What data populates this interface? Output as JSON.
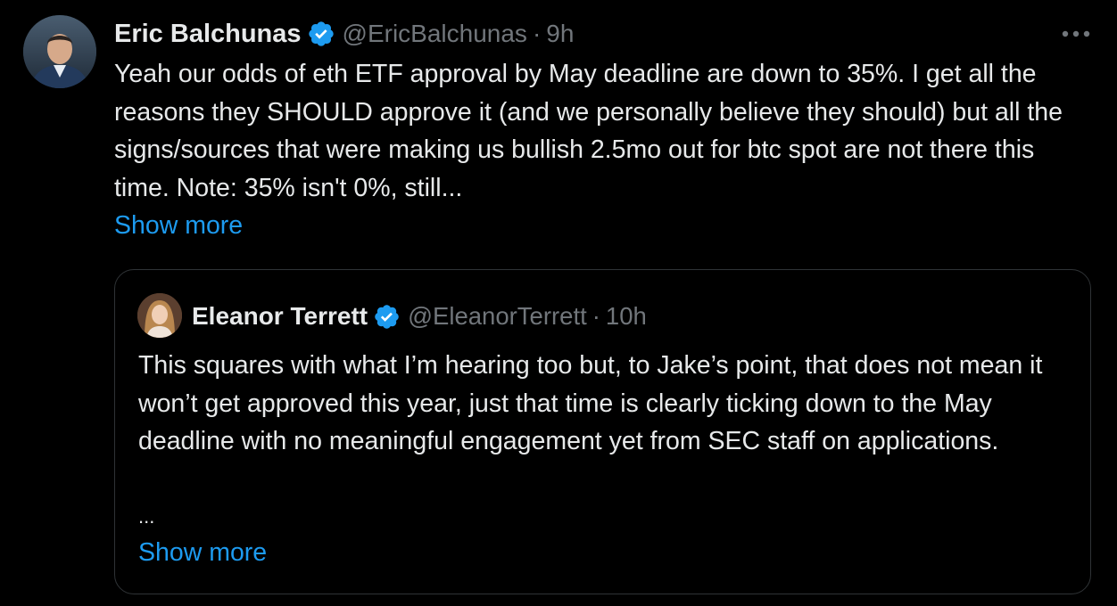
{
  "tweet": {
    "author_name": "Eric Balchunas",
    "author_handle": "@EricBalchunas",
    "separator": "·",
    "time": "9h",
    "text": "Yeah our odds of eth ETF approval by May deadline are down to 35%. I get all the reasons they SHOULD approve it (and we personally believe they should) but all the signs/sources that were making us bullish 2.5mo out for btc spot are not there this time. Note: 35% isn't 0%, still...",
    "show_more": "Show more",
    "more_icon": "more-horizontal-icon",
    "verified_icon": "verified-badge-icon"
  },
  "quoted_tweet": {
    "author_name": "Eleanor Terrett",
    "author_handle": "@EleanorTerrett",
    "separator": "·",
    "time": "10h",
    "text": "This squares with what I’m hearing too but, to Jake’s point, that does not mean it won’t get approved this year, just that time is clearly ticking down to the May deadline with no meaningful engagement yet from SEC staff on applications.",
    "ellipsis": "...",
    "show_more": "Show more",
    "verified_icon": "verified-badge-icon"
  },
  "colors": {
    "background": "#000000",
    "text": "#e7e9ea",
    "secondary": "#71767b",
    "link": "#1d9bf0",
    "border": "#2f3336",
    "verified": "#1d9bf0"
  }
}
